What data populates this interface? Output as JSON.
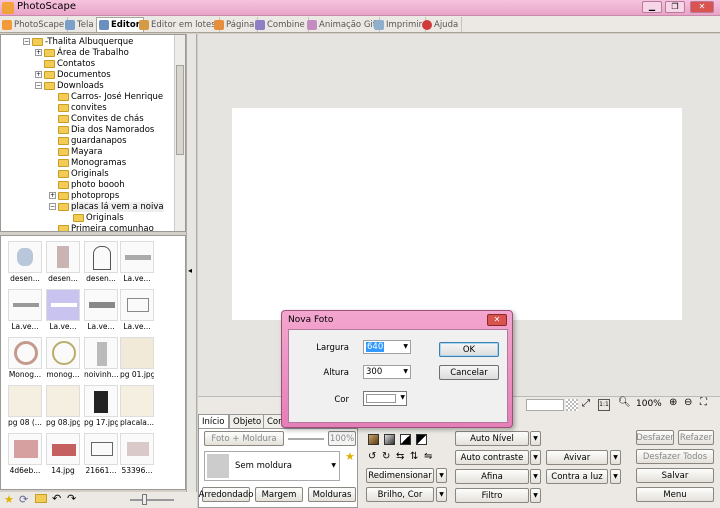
{
  "window": {
    "title": "PhotoScape",
    "colors": {
      "titlebar": "#ecaace",
      "accent": "#e57fb7"
    }
  },
  "tabs": [
    {
      "label": "PhotoScape",
      "icon": "photoscape-icon"
    },
    {
      "label": "Tela",
      "icon": "screen-icon"
    },
    {
      "label": "Editor",
      "icon": "editor-icon"
    },
    {
      "label": "Editor em lotes",
      "icon": "batch-editor-icon"
    },
    {
      "label": "Página",
      "icon": "page-icon"
    },
    {
      "label": "Combine",
      "icon": "combine-icon"
    },
    {
      "label": "Animação Gif",
      "icon": "gif-icon"
    },
    {
      "label": "Imprimir",
      "icon": "print-icon"
    },
    {
      "label": "Ajuda",
      "icon": "help-icon"
    }
  ],
  "tree": [
    {
      "label": "-Thalita Albuquerque",
      "level": 0
    },
    {
      "label": "Área de Trabalho",
      "level": 1
    },
    {
      "label": "Contatos",
      "level": 1
    },
    {
      "label": "Documentos",
      "level": 1
    },
    {
      "label": "Downloads",
      "level": 1
    },
    {
      "label": "Carros- José Henrique",
      "level": 2
    },
    {
      "label": "convites",
      "level": 2
    },
    {
      "label": "Convites de chás",
      "level": 2
    },
    {
      "label": "Dia dos Namorados",
      "level": 2
    },
    {
      "label": "guardanapos",
      "level": 2
    },
    {
      "label": "Mayara",
      "level": 2
    },
    {
      "label": "Monogramas",
      "level": 2
    },
    {
      "label": "Originals",
      "level": 2
    },
    {
      "label": "photo boooh",
      "level": 2
    },
    {
      "label": "photoprops",
      "level": 2
    },
    {
      "label": "placas lá vem a noiva",
      "level": 2
    },
    {
      "label": "Originals",
      "level": 3
    },
    {
      "label": "Primeira comunhao",
      "level": 2
    }
  ],
  "thumbnails": [
    "desen...",
    "desen...",
    "desen...",
    "La.ve...",
    "La.ve...",
    "La.ve...",
    "La.ve...",
    "La.ve...",
    "Monog...",
    "monog...",
    "noivinh...",
    "pg 01.jpg",
    "pg 08 (...",
    "pg 08.jpg",
    "pg 17.jpg",
    "placala...",
    "4d6eb...",
    "14.jpg",
    "21661...",
    "53396..."
  ],
  "zoom": {
    "level": "100%"
  },
  "panel": {
    "tabs": [
      "Início",
      "Objeto",
      "Cor"
    ],
    "frame_button": "Foto + Moldura",
    "frame_percent": "100%",
    "frame_select": "Sem moldura",
    "round_button": "Arredondado",
    "margin_button": "Margem",
    "frames_button": "Molduras",
    "auto_level": "Auto Nível",
    "auto_contrast": "Auto contraste",
    "sharpen": "Afina",
    "resize": "Redimensionar",
    "brightness": "Brilho, Cor",
    "filter": "Filtro",
    "revive": "Avivar",
    "backlight": "Contra a luz",
    "undo": "Desfazer",
    "redo": "Refazer",
    "undo_all": "Desfazer Todos",
    "save": "Salvar",
    "menu": "Menu"
  },
  "dialog": {
    "title": "Nova Foto",
    "width_label": "Largura",
    "width_value": "640",
    "height_label": "Altura",
    "height_value": "300",
    "color_label": "Cor",
    "ok": "OK",
    "cancel": "Cancelar"
  }
}
